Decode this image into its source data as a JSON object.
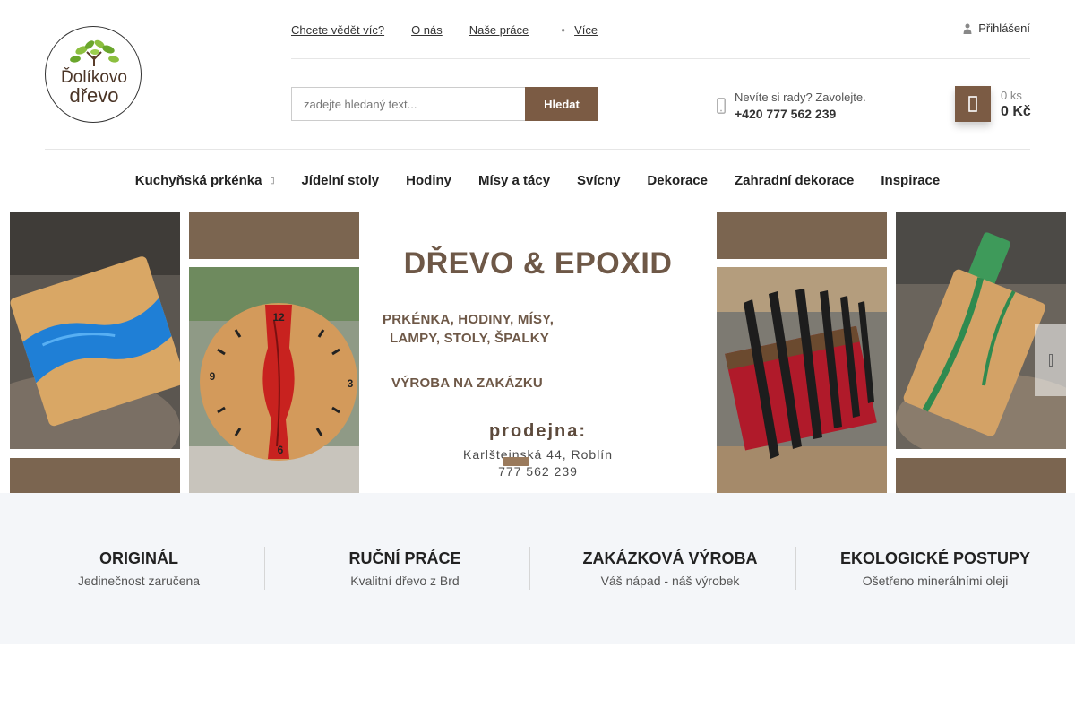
{
  "header": {
    "logo": {
      "line1": "Ďolíkovo",
      "line2": "dřevo"
    },
    "top_nav": [
      {
        "label": "Chcete vědět víc?"
      },
      {
        "label": "O nás"
      },
      {
        "label": "Naše práce"
      }
    ],
    "more_label": "Více",
    "login_label": "Přihlášení",
    "search": {
      "placeholder": "zadejte hledaný text...",
      "button_label": "Hledat"
    },
    "help": {
      "text": "Nevíte si rady? Zavolejte.",
      "phone": "+420 777 562 239"
    },
    "cart": {
      "count": "0 ks",
      "total": "0 Kč"
    }
  },
  "main_nav": [
    {
      "label": "Kuchyňská prkénka",
      "has_submenu": true
    },
    {
      "label": "Jídelní stoly"
    },
    {
      "label": "Hodiny"
    },
    {
      "label": "Mísy a tácy"
    },
    {
      "label": "Svícny"
    },
    {
      "label": "Dekorace"
    },
    {
      "label": "Zahradní dekorace"
    },
    {
      "label": "Inspirace"
    }
  ],
  "banner": {
    "title": "DŘEVO & EPOXID",
    "line1": "PRKÉNKA, HODINY, MÍSY,",
    "line2": "LAMPY, STOLY, ŠPALKY",
    "line3": "VÝROBA NA ZAKÁZKU",
    "shop_label": "prodejna:",
    "address": "Karlštejnská 44, Roblín",
    "phone": "777 562 239",
    "clock_numerals": [
      "12",
      "3",
      "6",
      "9"
    ]
  },
  "benefits": [
    {
      "title": "ORIGINÁL",
      "subtitle": "Jedinečnost zaručena"
    },
    {
      "title": "RUČNÍ PRÁCE",
      "subtitle": "Kvalitní dřevo z Brd"
    },
    {
      "title": "ZAKÁZKOVÁ VÝROBA",
      "subtitle": "Váš nápad - náš výrobek"
    },
    {
      "title": "EKOLOGICKÉ POSTUPY",
      "subtitle": "Ošetřeno minerálními oleji"
    }
  ],
  "colors": {
    "accent_brown": "#7b5b44",
    "banner_brown": "#7b6550",
    "benefits_bg": "#f4f6f9"
  }
}
